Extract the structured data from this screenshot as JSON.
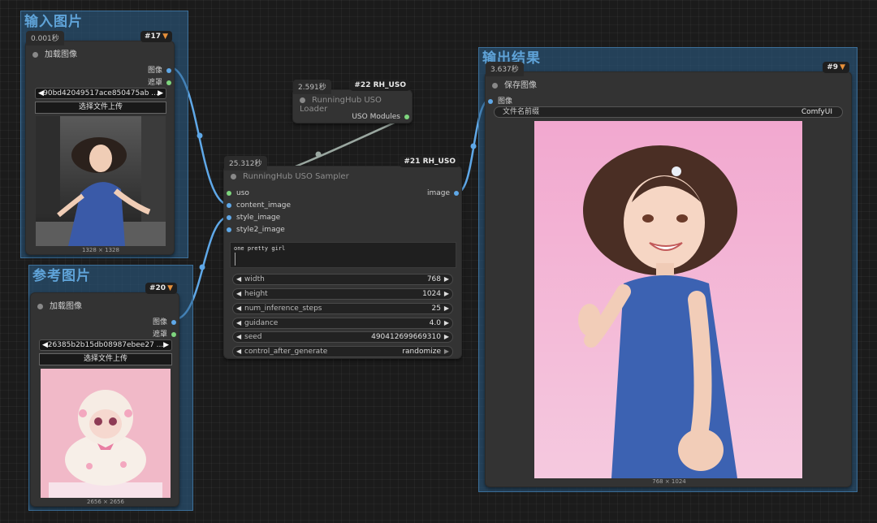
{
  "colors": {
    "canvas": "#1b1b1b",
    "group_fill": "#2c608c",
    "group_title": "#5fa3d8",
    "node_bg": "#333333",
    "wire_blue": "#5fa8e8",
    "wire_gray": "#9aa7a0",
    "slot_green": "#7ed67e"
  },
  "groups": {
    "input": {
      "title": "输入图片"
    },
    "reference": {
      "title": "参考图片"
    },
    "output": {
      "title": "输出结果"
    }
  },
  "nodes": {
    "load1": {
      "time": "0.001秒",
      "id": "#17",
      "badge_icon": "fox-icon",
      "title": "加载图像",
      "outputs": [
        "图像",
        "遮罩"
      ],
      "file": "90bd42049517ace850475ab ...",
      "upload_label": "选择文件上传",
      "image_size": "1328 × 1328"
    },
    "load2": {
      "time": "",
      "id": "#20",
      "badge_icon": "fox-icon",
      "title": "加载图像",
      "outputs": [
        "图像",
        "遮罩"
      ],
      "file": "26385b2b15db08987ebee27 ...",
      "upload_label": "选择文件上传",
      "image_size": "2656 × 2656"
    },
    "loader": {
      "time": "2.591秒",
      "id": "#22 RH_USO",
      "title": "RunningHub USO Loader",
      "output": "USO Modules"
    },
    "sampler": {
      "time": "25.312秒",
      "id": "#21 RH_USO",
      "title": "RunningHub USO Sampler",
      "inputs": [
        "uso",
        "content_image",
        "style_image",
        "style2_image"
      ],
      "output": "image",
      "prompt": "one pretty girl",
      "widgets": [
        {
          "label": "width",
          "value": "768"
        },
        {
          "label": "height",
          "value": "1024"
        },
        {
          "label": "num_inference_steps",
          "value": "25"
        },
        {
          "label": "guidance",
          "value": "4.0"
        },
        {
          "label": "seed",
          "value": "490412699669310"
        },
        {
          "label": "control_after_generate",
          "value": "randomize"
        }
      ]
    },
    "save": {
      "time": "3.637秒",
      "id": "#9",
      "badge_icon": "fox-icon",
      "title": "保存图像",
      "input": "图像",
      "prefix_label": "文件名前缀",
      "prefix_value": "ComfyUI",
      "image_size": "768 × 1024"
    }
  }
}
